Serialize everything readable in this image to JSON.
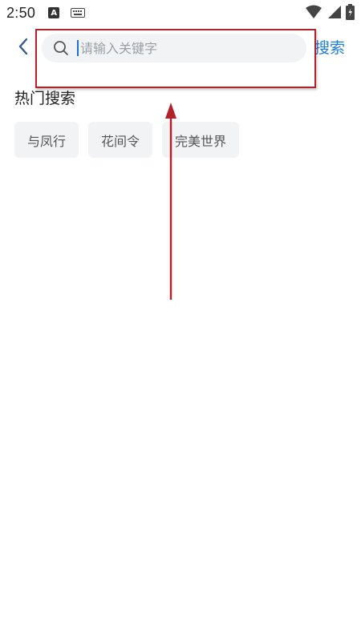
{
  "status_bar": {
    "time": "2:50",
    "app_icon_letter": "A",
    "icons": [
      "a-icon",
      "keyboard-icon",
      "wifi-icon",
      "signal-icon",
      "battery-icon"
    ]
  },
  "header": {
    "back_icon": "chevron-left-icon",
    "search": {
      "placeholder": "请输入关键字",
      "value": ""
    },
    "submit_label": "搜索"
  },
  "hot_search": {
    "title": "热门搜索",
    "tags": [
      "与凤行",
      "花间令",
      "完美世界"
    ]
  },
  "colors": {
    "accent": "#1e7ed8",
    "annotation": "#b3222a",
    "chip_bg": "#f1f3f5"
  }
}
